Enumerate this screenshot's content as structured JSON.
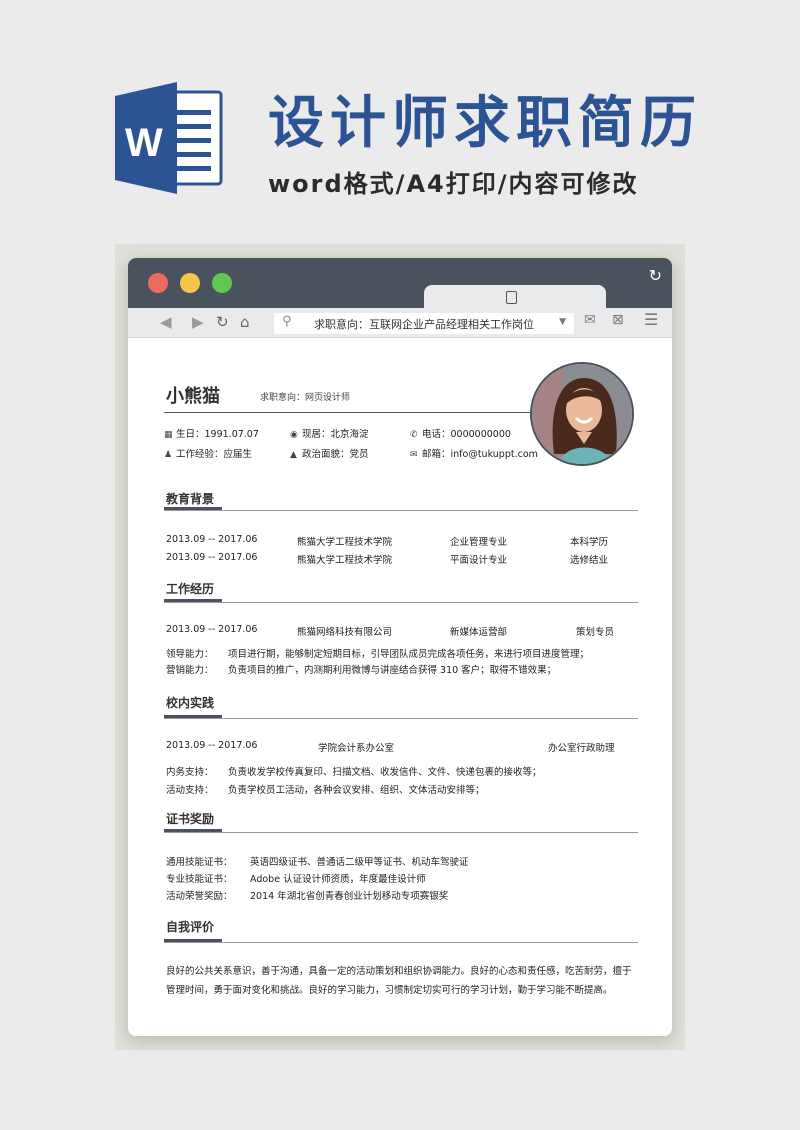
{
  "header": {
    "logo_letter": "W",
    "title": "设计师求职简历",
    "subtitle": "word格式/A4打印/内容可修改"
  },
  "browser": {
    "url_text": "求职意向：互联网企业产品经理相关工作岗位",
    "icons": [
      "back-arrow-icon",
      "forward-arrow-icon",
      "reload-icon",
      "home-icon",
      "search-icon",
      "mail-icon",
      "inbox-icon",
      "menu-icon"
    ]
  },
  "profile": {
    "name": "小熊猫",
    "intent": "求职意向：网页设计师",
    "birth": "生日：1991.07.07",
    "residence": "现居：北京海淀",
    "phone": "电话：0000000000",
    "experience": "工作经验：应届生",
    "politics": "政治面貌：党员",
    "email": "邮箱：info@tukuppt.com"
  },
  "education": {
    "title": "教育背景",
    "rows": [
      {
        "period": "2013.09 -- 2017.06",
        "school": "熊猫大学工程技术学院",
        "major": "企业管理专业",
        "degree": "本科学历"
      },
      {
        "period": "2013.09 -- 2017.06",
        "school": "熊猫大学工程技术学院",
        "major": "平面设计专业",
        "degree": "选修结业"
      }
    ]
  },
  "work": {
    "title": "工作经历",
    "period": "2013.09 -- 2017.06",
    "company": "熊猫网络科技有限公司",
    "dept": "新媒体运营部",
    "role": "策划专员",
    "details": [
      {
        "label": "领导能力：",
        "text": "项目进行期，能够制定短期目标，引导团队成员完成各项任务，来进行项目进度管理；"
      },
      {
        "label": "营销能力：",
        "text": "负责项目的推广，内测期利用微博与讲座结合获得 310 客户；取得不错效果；"
      }
    ]
  },
  "campus": {
    "title": "校内实践",
    "period": "2013.09 -- 2017.06",
    "org": "学院会计系办公室",
    "role": "办公室行政助理",
    "details": [
      {
        "label": "内务支持：",
        "text": "负责收发学校传真复印、扫描文档、收发信件、文件、快递包裹的接收等；"
      },
      {
        "label": "活动支持：",
        "text": "负责学校员工活动，各种会议安排、组织、文体活动安排等；"
      }
    ]
  },
  "certs": {
    "title": "证书奖励",
    "rows": [
      {
        "label": "通用技能证书：",
        "text": "英语四级证书、普通话二级甲等证书、机动车驾驶证"
      },
      {
        "label": "专业技能证书：",
        "text": "Adobe 认证设计师资质，年度最佳设计师"
      },
      {
        "label": "活动荣誉奖励：",
        "text": "2014 年湖北省创青春创业计划移动专项赛银奖"
      }
    ]
  },
  "self": {
    "title": "自我评价",
    "text": "良好的公共关系意识，善于沟通，具备一定的活动策划和组织协调能力。良好的心态和责任感，吃苦耐劳，擅于管理时间，勇于面对变化和挑战。良好的学习能力，习惯制定切实可行的学习计划，勤于学习能不断提高。"
  },
  "colors": {
    "brand_blue": "#2c5494",
    "frame_dark": "#4a525e",
    "dot_red": "#ee6a5e",
    "dot_yellow": "#f5c64a",
    "dot_green": "#62c554"
  }
}
